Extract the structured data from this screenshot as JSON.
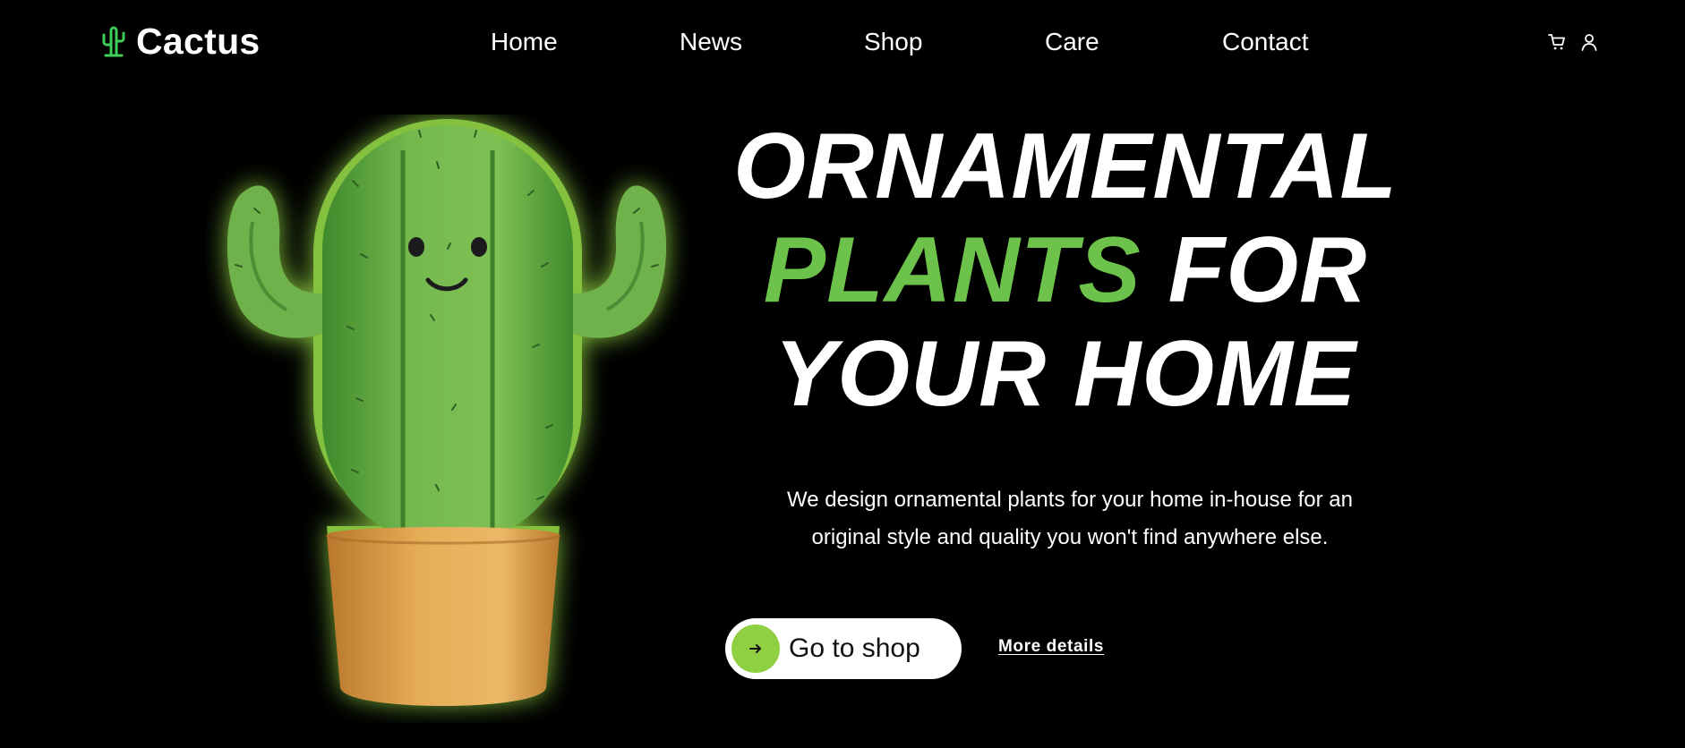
{
  "brand": {
    "name": "Cactus",
    "icon": "cactus-icon",
    "icon_color": "#3ecf5a"
  },
  "nav": {
    "items": [
      {
        "label": "Home"
      },
      {
        "label": "News"
      },
      {
        "label": "Shop"
      },
      {
        "label": "Care"
      },
      {
        "label": "Contact"
      }
    ]
  },
  "header_actions": {
    "cart_icon": "cart-icon",
    "account_icon": "user-icon"
  },
  "hero": {
    "image": "cactus-illustration",
    "title_line1": "ORNAMENTAL",
    "title_line2_accent": "PLANTS",
    "title_line2_rest": " FOR",
    "title_line3": "YOUR HOME",
    "description_line1": "We design ornamental plants for your home in-house for an",
    "description_line2": "original style and quality you won't find anywhere else.",
    "primary_button": {
      "label": "Go to shop",
      "icon": "arrow-right-icon"
    },
    "secondary_link": "More details"
  },
  "colors": {
    "background": "#000000",
    "text": "#ffffff",
    "accent_green": "#6cc24a",
    "button_circle": "#8fd042",
    "button_bg": "#ffffff",
    "pot": "#e0a64e"
  }
}
